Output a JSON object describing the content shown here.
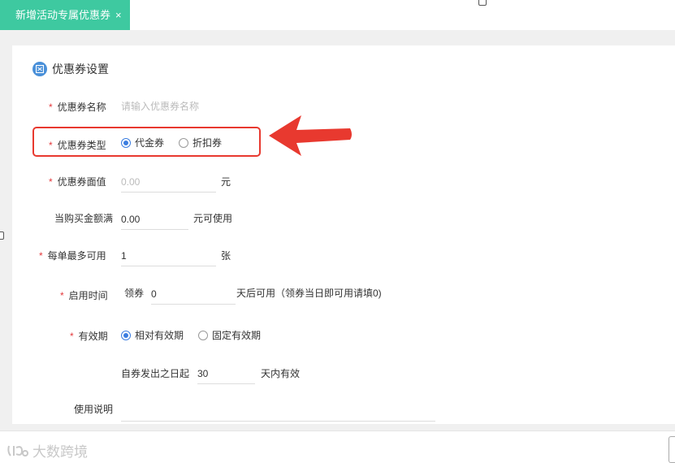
{
  "tab": {
    "title": "新增活动专属优惠券",
    "close": "×"
  },
  "section": {
    "title": "优惠券设置"
  },
  "form": {
    "coupon_name": {
      "required": "*",
      "label": "优惠券名称",
      "placeholder": "请输入优惠券名称",
      "value": ""
    },
    "coupon_type": {
      "required": "*",
      "label": "优惠券类型",
      "options": [
        {
          "label": "代金券",
          "checked": true
        },
        {
          "label": "折扣券",
          "checked": false
        }
      ]
    },
    "face_value": {
      "required": "*",
      "label": "优惠券面值",
      "placeholder": "0.00",
      "value": "",
      "unit": "元"
    },
    "min_purchase": {
      "label": "当购买金额满",
      "value": "0.00",
      "unit": "元可使用"
    },
    "max_per_order": {
      "required": "*",
      "label": "每单最多可用",
      "value": "1",
      "unit": "张"
    },
    "start_time": {
      "required": "*",
      "label": "启用时间",
      "prefix": "领券",
      "value": "0",
      "suffix": "天后可用（领券当日即可用请填0)"
    },
    "validity": {
      "required": "*",
      "label": "有效期",
      "options": [
        {
          "label": "相对有效期",
          "checked": true
        },
        {
          "label": "固定有效期",
          "checked": false
        }
      ],
      "prefix": "自券发出之日起",
      "value": "30",
      "suffix": "天内有效"
    },
    "usage_note": {
      "label": "使用说明",
      "value": ""
    }
  },
  "watermark": {
    "text": "大数跨境"
  },
  "colors": {
    "tab_bg": "#3ec9a0",
    "highlight": "#e8392f",
    "radio_active": "#3b7de0",
    "required": "#e4393c"
  }
}
